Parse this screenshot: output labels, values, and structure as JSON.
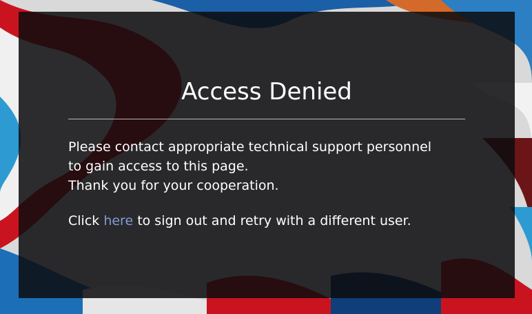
{
  "page": {
    "title": "Access Denied",
    "message_lines": [
      "Please contact appropriate technical support personnel",
      "to gain access to this page.",
      "Thank you for your cooperation."
    ],
    "signout": {
      "prefix": "Click ",
      "link_label": "here",
      "suffix": " to sign out and retry with a different user."
    }
  },
  "colors": {
    "panel_background": "#0c0c0e",
    "text": "#ffffff",
    "link": "#7f9bd6",
    "divider": "#b9b9b9"
  }
}
